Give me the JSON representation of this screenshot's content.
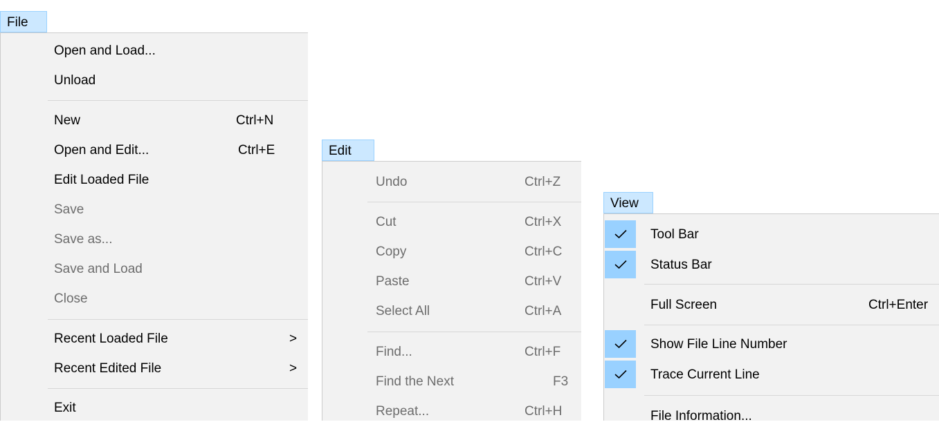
{
  "file_menu": {
    "title": "File",
    "items": [
      {
        "label": "Open and Load...",
        "shortcut": "",
        "enabled": true
      },
      {
        "label": "Unload",
        "shortcut": "",
        "enabled": true
      },
      {
        "label": "New",
        "shortcut": "Ctrl+N",
        "enabled": true
      },
      {
        "label": "Open and Edit...",
        "shortcut": "Ctrl+E",
        "enabled": true
      },
      {
        "label": "Edit Loaded File",
        "shortcut": "",
        "enabled": true
      },
      {
        "label": "Save",
        "shortcut": "",
        "enabled": false
      },
      {
        "label": "Save as...",
        "shortcut": "",
        "enabled": false
      },
      {
        "label": "Save and Load",
        "shortcut": "",
        "enabled": false
      },
      {
        "label": "Close",
        "shortcut": "",
        "enabled": false
      },
      {
        "label": "Recent Loaded File",
        "shortcut": ">",
        "enabled": true
      },
      {
        "label": "Recent Edited File",
        "shortcut": ">",
        "enabled": true
      },
      {
        "label": "Exit",
        "shortcut": "",
        "enabled": true
      }
    ]
  },
  "edit_menu": {
    "title": "Edit",
    "items": [
      {
        "label": "Undo",
        "shortcut": "Ctrl+Z",
        "enabled": false
      },
      {
        "label": "Cut",
        "shortcut": "Ctrl+X",
        "enabled": false
      },
      {
        "label": "Copy",
        "shortcut": "Ctrl+C",
        "enabled": false
      },
      {
        "label": "Paste",
        "shortcut": "Ctrl+V",
        "enabled": false
      },
      {
        "label": "Select All",
        "shortcut": "Ctrl+A",
        "enabled": false
      },
      {
        "label": "Find...",
        "shortcut": "Ctrl+F",
        "enabled": false
      },
      {
        "label": "Find the Next",
        "shortcut": "F3",
        "enabled": false
      },
      {
        "label": "Repeat...",
        "shortcut": "Ctrl+H",
        "enabled": false
      }
    ]
  },
  "view_menu": {
    "title": "View",
    "items": [
      {
        "label": "Tool Bar",
        "shortcut": "",
        "checked": true
      },
      {
        "label": "Status Bar",
        "shortcut": "",
        "checked": true
      },
      {
        "label": "Full Screen",
        "shortcut": "Ctrl+Enter",
        "checked": false
      },
      {
        "label": "Show File Line Number",
        "shortcut": "",
        "checked": true
      },
      {
        "label": "Trace Current Line",
        "shortcut": "",
        "checked": true
      },
      {
        "label": "File Information...",
        "shortcut": "",
        "checked": false
      }
    ]
  },
  "colors": {
    "menu_bg": "#f2f2f2",
    "highlight": "#cce8ff",
    "check_bg": "#99d1ff",
    "disabled_text": "#6d6d6d",
    "separator": "#d7d7d7"
  },
  "icons": {
    "check": "check-icon"
  }
}
